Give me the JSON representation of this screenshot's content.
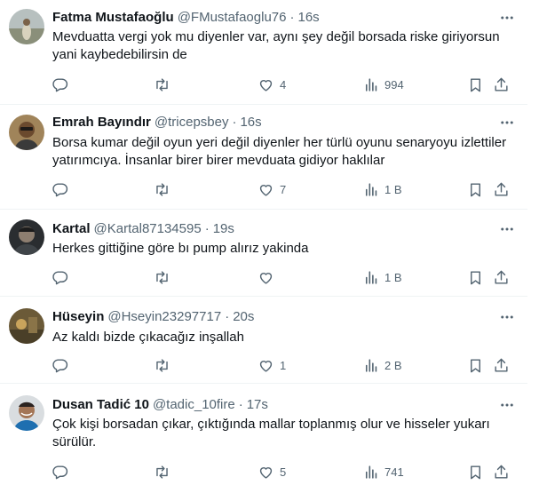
{
  "tweets": [
    {
      "name": "Fatma Mustafaoğlu",
      "handle": "@FMustafaoglu76",
      "separator": "·",
      "time": "16s",
      "text": "Mevduatta vergi yok mu diyenler var, aynı şey değil borsada riske giriyorsun yani kaybedebilirsin de",
      "likes": "4",
      "views": "994"
    },
    {
      "name": "Emrah Bayındır",
      "handle": "@tricepsbey",
      "separator": "·",
      "time": "16s",
      "text": "Borsa kumar değil oyun yeri değil diyenler her türlü oyunu senaryoyu izlettiler yatırımcıya. İnsanlar birer birer mevduata gidiyor haklılar",
      "likes": "7",
      "views": "1 B"
    },
    {
      "name": "Kartal",
      "handle": "@Kartal87134595",
      "separator": "·",
      "time": "19s",
      "text": "Herkes gittiğine göre bı pump alırız yakinda",
      "likes": "",
      "views": "1 B"
    },
    {
      "name": "Hüseyin",
      "handle": "@Hseyin23297717",
      "separator": "·",
      "time": "20s",
      "text": "Az kaldı bizde çıkacağız inşallah",
      "likes": "1",
      "views": "2 B"
    },
    {
      "name": "Dusan Tadić 10",
      "handle": "@tadic_10fire",
      "separator": "·",
      "time": "17s",
      "text": "Çok kişi borsadan çıkar, çıktığında mallar toplanmış olur ve hisseler yukarı sürülür.",
      "likes": "5",
      "views": "741"
    }
  ],
  "icons": {
    "reply": "reply-icon",
    "retweet": "retweet-icon",
    "like": "heart-icon",
    "views": "views-icon",
    "bookmark": "bookmark-icon",
    "share": "share-icon",
    "more": "more-icon"
  },
  "colors": {
    "primary_text": "#0f1419",
    "secondary_text": "#536471",
    "divider": "#eff3f4"
  }
}
